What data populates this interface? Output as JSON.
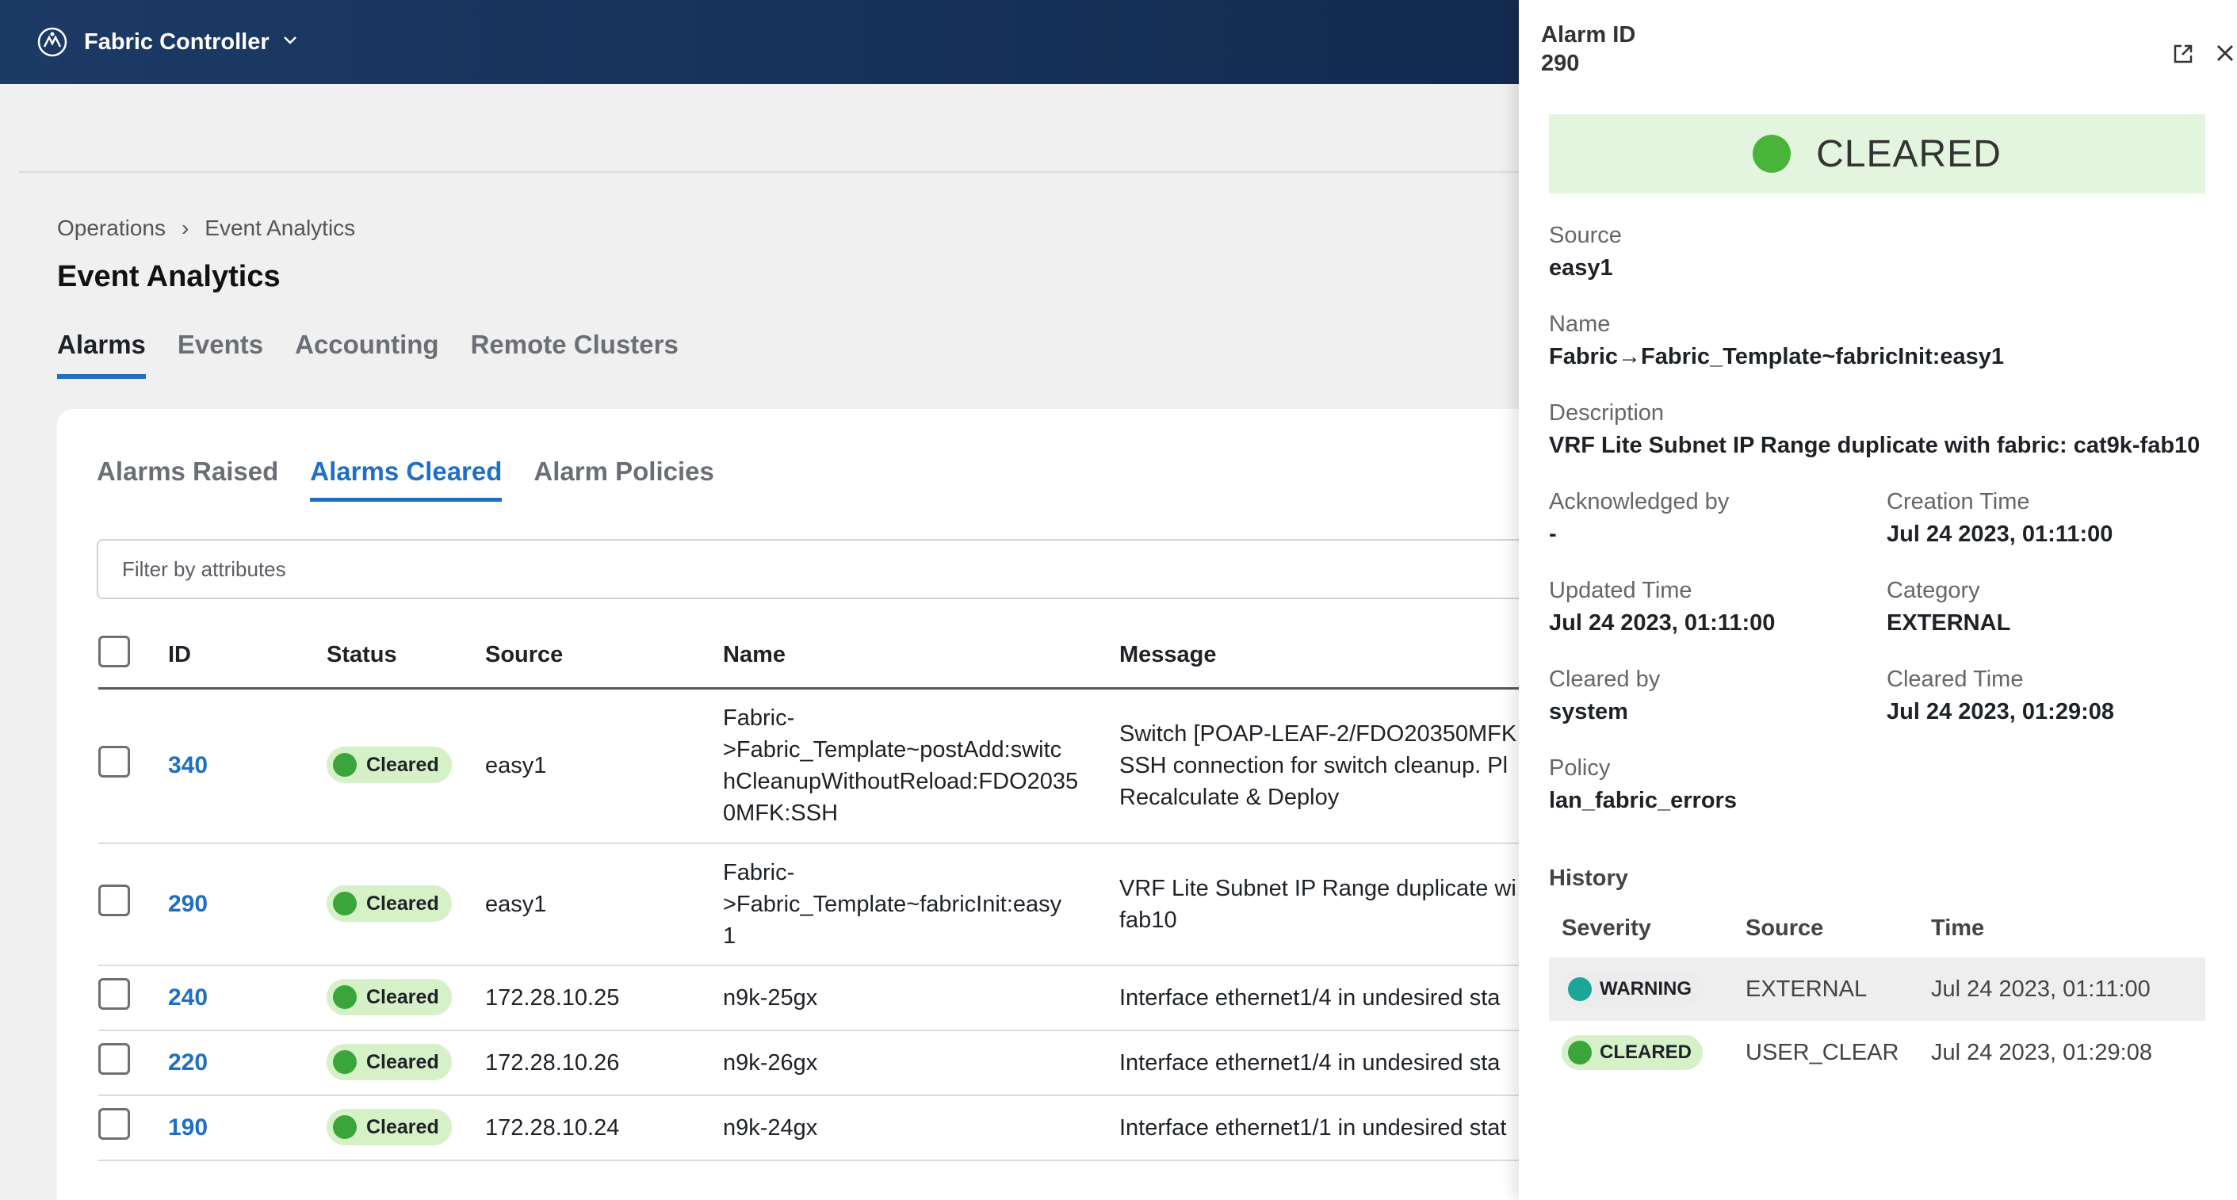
{
  "topbar": {
    "app_title": "Fabric Controller",
    "logo_icon": "fabric-logo-icon",
    "menu_icon": "chevron-down-icon"
  },
  "breadcrumb": {
    "items": [
      "Operations",
      "Event Analytics"
    ],
    "separator": "›"
  },
  "page_title": "Event Analytics",
  "main_tabs": [
    {
      "label": "Alarms",
      "active": true
    },
    {
      "label": "Events",
      "active": false
    },
    {
      "label": "Accounting",
      "active": false
    },
    {
      "label": "Remote Clusters",
      "active": false
    }
  ],
  "sub_tabs": [
    {
      "label": "Alarms Raised",
      "active": false
    },
    {
      "label": "Alarms Cleared",
      "active": true
    },
    {
      "label": "Alarm Policies",
      "active": false
    }
  ],
  "filter": {
    "placeholder": "Filter by attributes"
  },
  "table": {
    "columns": [
      "ID",
      "Status",
      "Source",
      "Name",
      "Message"
    ],
    "rows": [
      {
        "id": "340",
        "status": "Cleared",
        "source": "easy1",
        "name": [
          "Fabric-",
          ">Fabric_Template~postAdd:switc",
          "hCleanupWithoutReload:FDO2035",
          "0MFK:SSH"
        ],
        "message": [
          "Switch [POAP-LEAF-2/FDO20350MFK",
          "SSH connection for switch cleanup. Pl",
          "Recalculate & Deploy"
        ]
      },
      {
        "id": "290",
        "status": "Cleared",
        "source": "easy1",
        "name": [
          "Fabric-",
          ">Fabric_Template~fabricInit:easy",
          "1"
        ],
        "message": [
          "VRF Lite Subnet IP Range duplicate wi",
          "fab10"
        ]
      },
      {
        "id": "240",
        "status": "Cleared",
        "source": "172.28.10.25",
        "name": [
          "n9k-25gx"
        ],
        "message": [
          "Interface ethernet1/4 in undesired sta"
        ]
      },
      {
        "id": "220",
        "status": "Cleared",
        "source": "172.28.10.26",
        "name": [
          "n9k-26gx"
        ],
        "message": [
          "Interface ethernet1/4 in undesired sta"
        ]
      },
      {
        "id": "190",
        "status": "Cleared",
        "source": "172.28.10.24",
        "name": [
          "n9k-24gx"
        ],
        "message": [
          "Interface ethernet1/1 in undesired stat"
        ]
      }
    ]
  },
  "panel": {
    "alarm_id_label": "Alarm ID",
    "alarm_id": "290",
    "status": "CLEARED",
    "source_label": "Source",
    "source": "easy1",
    "name_label": "Name",
    "name": "Fabric→Fabric_Template~fabricInit:easy1",
    "description_label": "Description",
    "description": "VRF Lite Subnet IP Range duplicate with fabric: cat9k-fab10",
    "ack_label": "Acknowledged by",
    "ack": "-",
    "creation_label": "Creation Time",
    "creation": "Jul 24 2023, 01:11:00",
    "updated_label": "Updated Time",
    "updated": "Jul 24 2023, 01:11:00",
    "category_label": "Category",
    "category": "EXTERNAL",
    "cleared_by_label": "Cleared by",
    "cleared_by": "system",
    "cleared_time_label": "Cleared Time",
    "cleared_time": "Jul 24 2023, 01:29:08",
    "policy_label": "Policy",
    "policy": "lan_fabric_errors",
    "history": {
      "title": "History",
      "columns": [
        "Severity",
        "Source",
        "Time"
      ],
      "rows": [
        {
          "severity": "WARNING",
          "source": "EXTERNAL",
          "time": "Jul 24 2023, 01:11:00"
        },
        {
          "severity": "CLEARED",
          "source": "USER_CLEAR",
          "time": "Jul 24 2023, 01:29:08"
        }
      ]
    }
  },
  "colors": {
    "accent": "#1f6fc6",
    "cleared_green": "#3aa53a",
    "warning_teal": "#1aa79a",
    "topbar": "#1c3a66"
  }
}
